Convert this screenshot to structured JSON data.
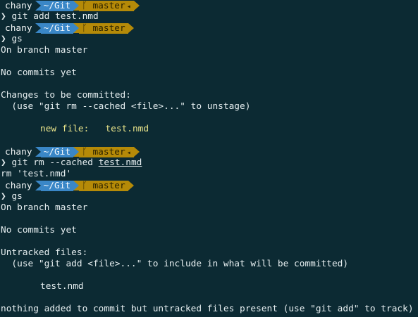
{
  "prompt": {
    "user": "chany",
    "directory": "~/Git",
    "branch_icon": "git-branch-icon",
    "branch": "master",
    "dirty_marker": "◂"
  },
  "caret": "❯",
  "lines": {
    "cmd1": "git add test.nmd",
    "cmd2": "gs",
    "out1_branch": "On branch master",
    "out1_blank1": "",
    "out1_nocommits": "No commits yet",
    "out1_blank2": "",
    "out1_changes": "Changes to be committed:",
    "out1_hint": "  (use \"git rm --cached <file>...\" to unstage)",
    "out1_blank3": "",
    "out1_newfile": "\tnew file:   test.nmd",
    "out1_blank4": "",
    "cmd3_prefix": "git rm --cached ",
    "cmd3_file": "test.nmd",
    "out2_rm": "rm 'test.nmd'",
    "cmd4": "gs",
    "out3_branch": "On branch master",
    "out3_blank1": "",
    "out3_nocommits": "No commits yet",
    "out3_blank2": "",
    "out3_untracked": "Untracked files:",
    "out3_hint": "  (use \"git add <file>...\" to include in what will be committed)",
    "out3_blank3": "",
    "out3_file": "\ttest.nmd",
    "out3_blank4": "",
    "out3_summary": "nothing added to commit but untracked files present (use \"git add\" to track)"
  }
}
